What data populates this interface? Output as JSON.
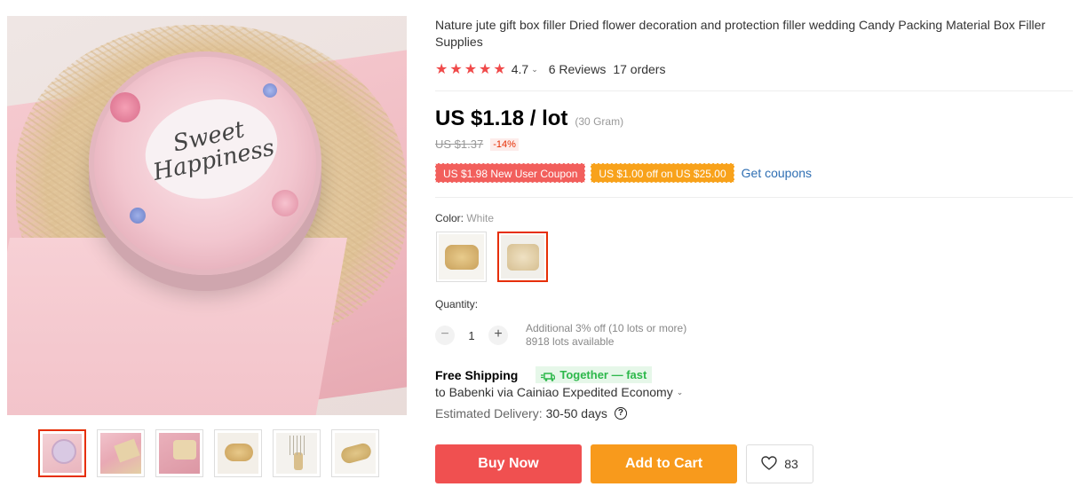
{
  "gallery": {
    "main_image_text": [
      "Sweet",
      "Happiness"
    ],
    "thumbnails": [
      {
        "name": "tin-in-box",
        "active": true
      },
      {
        "name": "pink-box-open",
        "active": false
      },
      {
        "name": "pink-box-straw",
        "active": false
      },
      {
        "name": "straw-bundle",
        "active": false
      },
      {
        "name": "straw-in-vase",
        "active": false
      },
      {
        "name": "straw-pile",
        "active": false
      }
    ]
  },
  "product": {
    "title": "Nature jute gift box filler Dried flower decoration and protection filler wedding Candy Packing Material Box Filler Supplies",
    "rating": {
      "stars": 5,
      "value": "4.7",
      "reviews": "6 Reviews",
      "orders": "17 orders"
    },
    "price": {
      "current": "US $1.18 / lot",
      "unit_note": "(30 Gram)",
      "original": "US $1.37",
      "discount": "-14%"
    },
    "coupons": {
      "new_user": "US $1.98 New User Coupon",
      "store": "US $1.00 off on US $25.00",
      "get_link": "Get coupons"
    },
    "color": {
      "label": "Color:",
      "selected": "White",
      "options": [
        "Natural",
        "White"
      ]
    },
    "quantity": {
      "label": "Quantity:",
      "value": "1",
      "minus": "−",
      "plus": "+",
      "note": "Additional 3% off (10 lots or more)",
      "available": "8918 lots available"
    },
    "shipping": {
      "free": "Free Shipping",
      "badge": "Together — fast",
      "to": "to Babenki via Cainiao Expedited Economy",
      "delivery_label": "Estimated Delivery:",
      "delivery_days": "30-50 days",
      "help": "?"
    },
    "actions": {
      "buy_now": "Buy Now",
      "add_to_cart": "Add to Cart",
      "wishlist_count": "83"
    }
  },
  "colors": {
    "accent_red": "#f05050",
    "accent_orange": "#f89a1c",
    "star": "#f04a4a",
    "link": "#2f6fb3",
    "green": "#2db84b"
  }
}
